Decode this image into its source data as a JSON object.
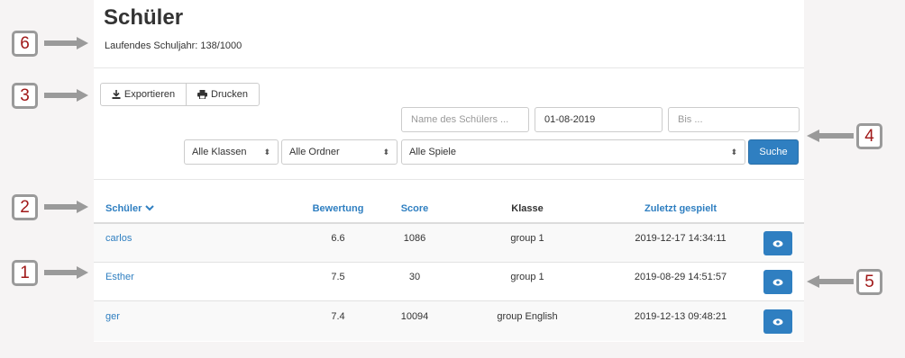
{
  "page": {
    "title": "Schüler",
    "subtitle": "Laufendes Schuljahr: 138/1000"
  },
  "toolbar": {
    "export_label": "Exportieren",
    "print_label": "Drucken"
  },
  "filters": {
    "name_placeholder": "Name des Schülers ...",
    "date_from": "01-08-2019",
    "date_to_placeholder": "Bis ...",
    "class_select": "Alle Klassen",
    "folder_select": "Alle Ordner",
    "game_select": "Alle Spiele",
    "search_label": "Suche"
  },
  "table": {
    "columns": [
      "Schüler",
      "Bewertung",
      "Score",
      "Klasse",
      "Zuletzt gespielt"
    ],
    "rows": [
      {
        "name": "carlos",
        "rating": "6.6",
        "score": "1086",
        "class": "group 1",
        "last_played": "2019-12-17 14:34:11"
      },
      {
        "name": "Esther",
        "rating": "7.5",
        "score": "30",
        "class": "group 1",
        "last_played": "2019-08-29 14:51:57"
      },
      {
        "name": "ger",
        "rating": "7.4",
        "score": "10094",
        "class": "group English",
        "last_played": "2019-12-13 09:48:21"
      }
    ]
  },
  "callouts": [
    "1",
    "2",
    "3",
    "4",
    "5",
    "6"
  ],
  "colors": {
    "accent": "#2f7fc1",
    "callout_number": "#a01818",
    "callout_border": "#9a9a9a"
  },
  "icons": {
    "export": "download-icon",
    "print": "printer-icon",
    "sort": "chevron-down-icon",
    "view": "eye-icon"
  }
}
